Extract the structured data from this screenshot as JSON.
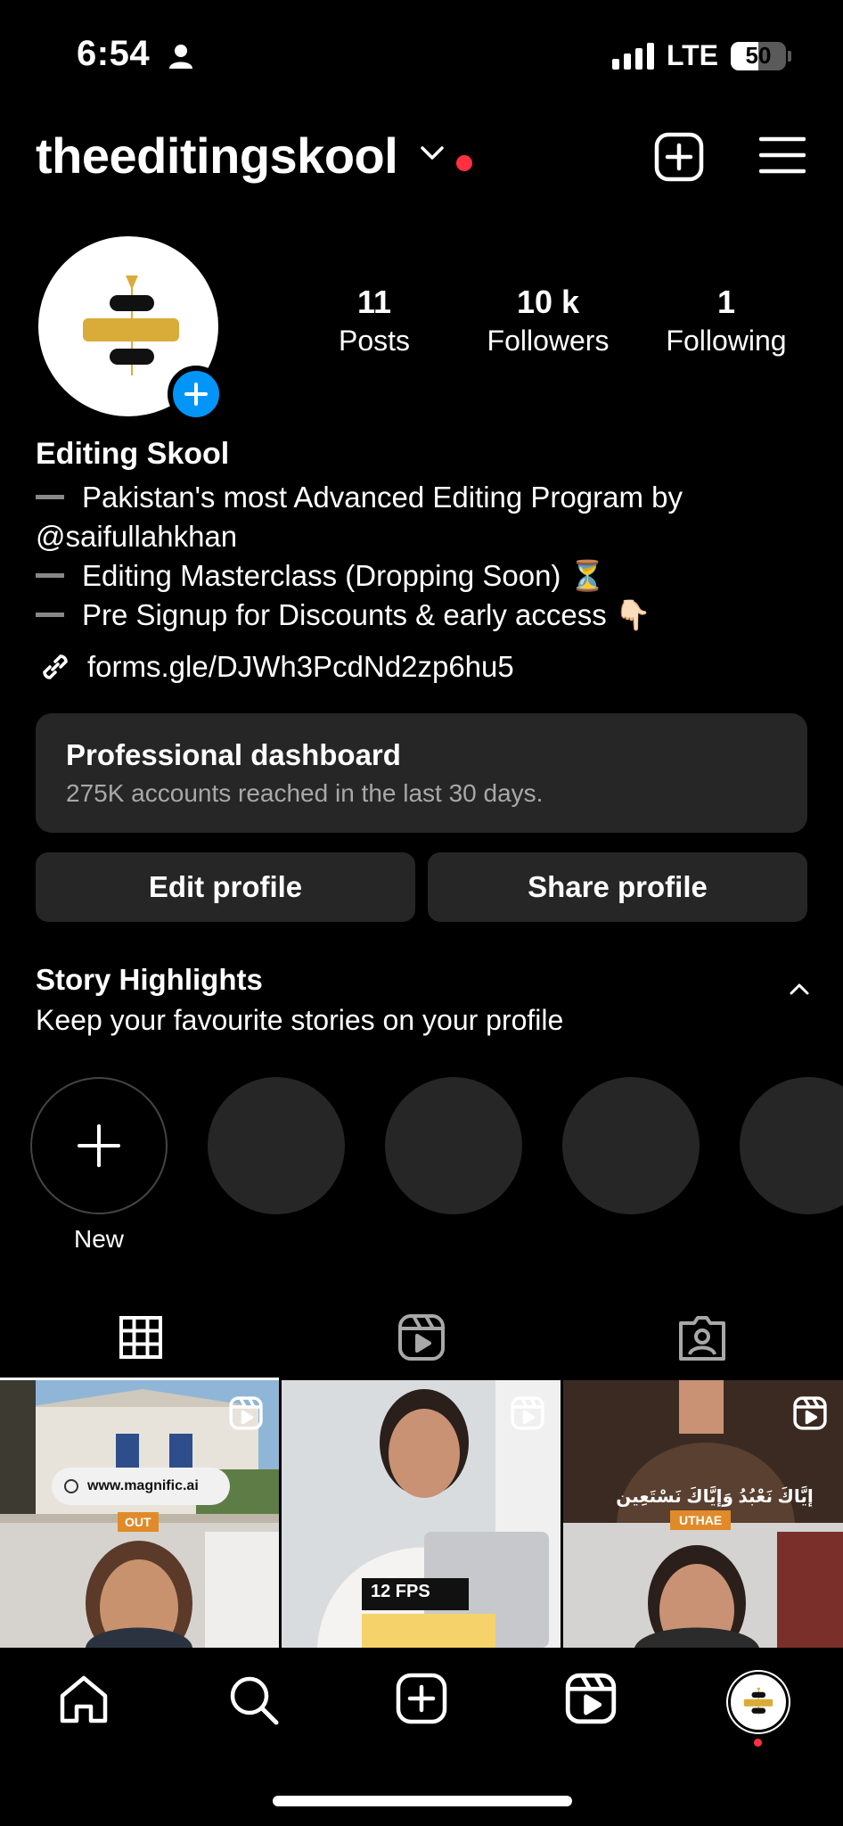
{
  "status_bar": {
    "time": "6:54",
    "network": "LTE",
    "battery": "50",
    "battery_level": 0.5
  },
  "header": {
    "username": "theeditingskool",
    "notification_color": "#ff3040"
  },
  "profile": {
    "stats": [
      {
        "value": "11",
        "label": "Posts"
      },
      {
        "value": "10 k",
        "label": "Followers"
      },
      {
        "value": "1",
        "label": "Following"
      }
    ],
    "display_name": "Editing Skool",
    "bio": {
      "line1": "Pakistan's most Advanced Editing Program by",
      "line2": "@saifullahkhan",
      "line3": "Editing Masterclass (Dropping Soon) ⏳",
      "line4": "Pre Signup for Discounts & early access 👇🏻"
    },
    "link": "forms.gle/DJWh3PcdNd2zp6hu5"
  },
  "dashboard": {
    "title": "Professional dashboard",
    "subtitle": "275K accounts reached in the last 30 days."
  },
  "actions": {
    "edit_label": "Edit profile",
    "share_label": "Share profile"
  },
  "highlights": {
    "title": "Story Highlights",
    "subtitle": "Keep your favourite stories on your profile",
    "new_label": "New"
  },
  "grid": {
    "post1": {
      "url_text": "www.magnific.ai",
      "badge": "OUT"
    },
    "post2": {
      "caption": "12 FPS"
    },
    "post3": {
      "subtitle": "إِيَّاكَ نَعْبُدُ وَإِيَّاكَ نَسْتَعِين",
      "badge": "UTHAE"
    }
  },
  "colors": {
    "accent_blue": "#0095f6",
    "brand_gold": "#d9ac3a",
    "surface": "#262626"
  }
}
